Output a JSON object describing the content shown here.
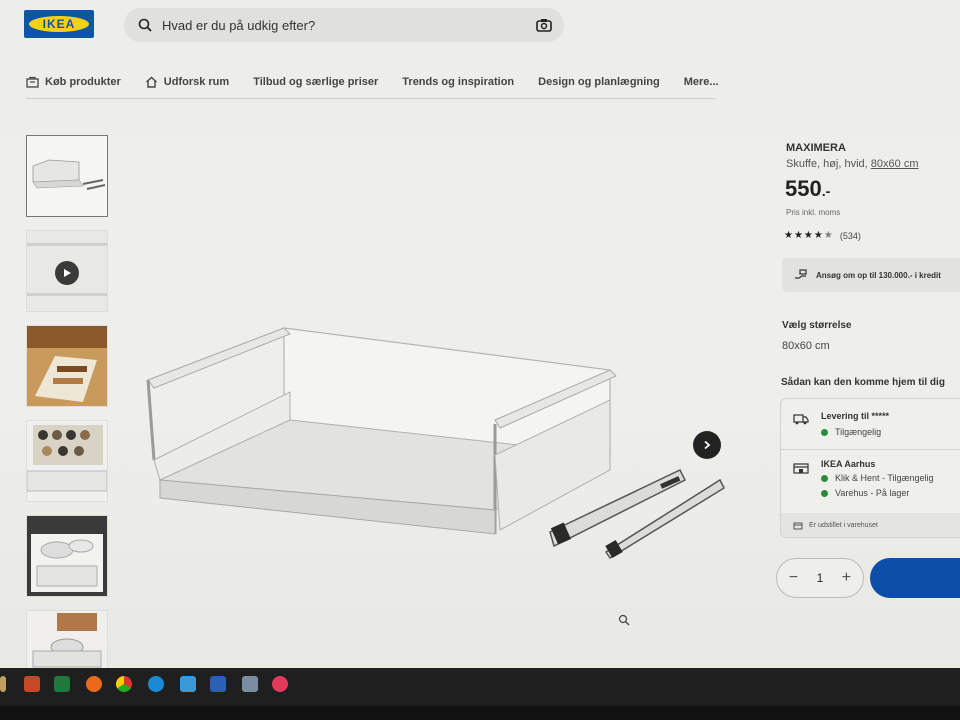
{
  "header": {
    "logo_text": "IKEA",
    "search_placeholder": "Hvad er du på udkig efter?"
  },
  "nav": {
    "items": [
      {
        "label": "Køb produkter",
        "icon": "shopping-bag-icon"
      },
      {
        "label": "Udforsk rum",
        "icon": "home-icon"
      },
      {
        "label": "Tilbud og særlige priser"
      },
      {
        "label": "Trends og inspiration"
      },
      {
        "label": "Design og planlægning"
      },
      {
        "label": "Mere..."
      }
    ]
  },
  "gallery": {
    "thumbnail_count": 6,
    "selected_index": 0
  },
  "product": {
    "name": "MAXIMERA",
    "description": "Skuffe, høj, hvid,",
    "size_link": "80x60 cm",
    "price": "550",
    "price_suffix": ".-",
    "vat_note": "Pris inkl. moms",
    "rating_count": "(534)",
    "rating_stars": 4.5,
    "credit_text": "Ansøg om op til 130.000.- i kredit"
  },
  "size": {
    "label": "Vælg størrelse",
    "value": "80x60 cm"
  },
  "delivery": {
    "title": "Sådan kan den komme hjem til dig",
    "shipping_title": "Levering til *****",
    "shipping_status": "Tilgængelig",
    "store_title": "IKEA Aarhus",
    "store_status_1": "Klik & Hent - Tilgængelig",
    "store_status_2": "Varehus - På lager",
    "showroom_text": "Er udstillet i varehuset"
  },
  "quantity": {
    "minus": "−",
    "value": "1",
    "plus": "+"
  },
  "colors": {
    "ikea_blue": "#0d56a6",
    "ikea_yellow": "#f7d117",
    "available_green": "#2b8a3e",
    "add_button": "#0b4fa8"
  }
}
